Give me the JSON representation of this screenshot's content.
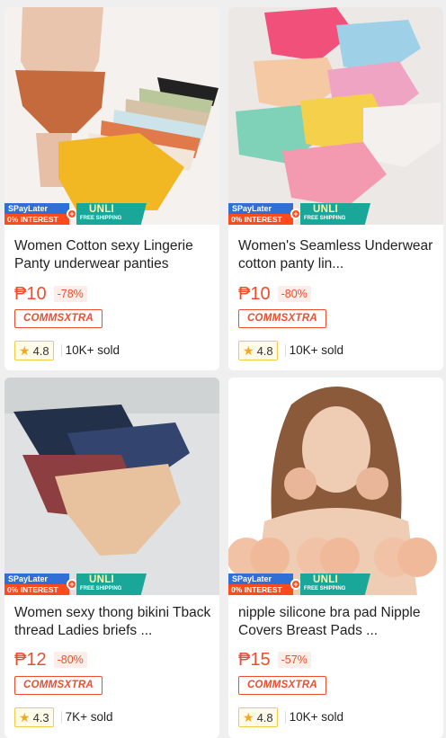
{
  "products": [
    {
      "title": "Women Cotton sexy Lingerie Panty underwear panties",
      "price": "₱10",
      "discount": "-78%",
      "badge": "COMMSXTRA",
      "rating": "4.8",
      "sold": "10K+ sold",
      "promo": {
        "spaylater": "SPayLater",
        "interest": "0% INTEREST",
        "unli": "UNLI",
        "free_shipping": "FREE SHIPPING"
      }
    },
    {
      "title": "Women's Seamless Underwear cotton panty lin...",
      "price": "₱10",
      "discount": "-80%",
      "badge": "COMMSXTRA",
      "rating": "4.8",
      "sold": "10K+ sold",
      "promo": {
        "spaylater": "SPayLater",
        "interest": "0% INTEREST",
        "unli": "UNLI",
        "free_shipping": "FREE SHIPPING"
      }
    },
    {
      "title": "Women sexy thong bikini Tback thread Ladies briefs ...",
      "price": "₱12",
      "discount": "-80%",
      "badge": "COMMSXTRA",
      "rating": "4.3",
      "sold": "7K+ sold",
      "promo": {
        "spaylater": "SPayLater",
        "interest": "0% INTEREST",
        "unli": "UNLI",
        "free_shipping": "FREE SHIPPING"
      }
    },
    {
      "title": "nipple silicone bra pad Nipple Covers Breast Pads ...",
      "price": "₱15",
      "discount": "-57%",
      "badge": "COMMSXTRA",
      "rating": "4.8",
      "sold": "10K+ sold",
      "promo": {
        "spaylater": "SPayLater",
        "interest": "0% INTEREST",
        "unli": "UNLI",
        "free_shipping": "FREE SHIPPING"
      }
    }
  ],
  "colors": {
    "accent": "#ee4d2d",
    "star": "#f5a623",
    "teal": "#19a79a",
    "blue": "#2f6fd6"
  }
}
